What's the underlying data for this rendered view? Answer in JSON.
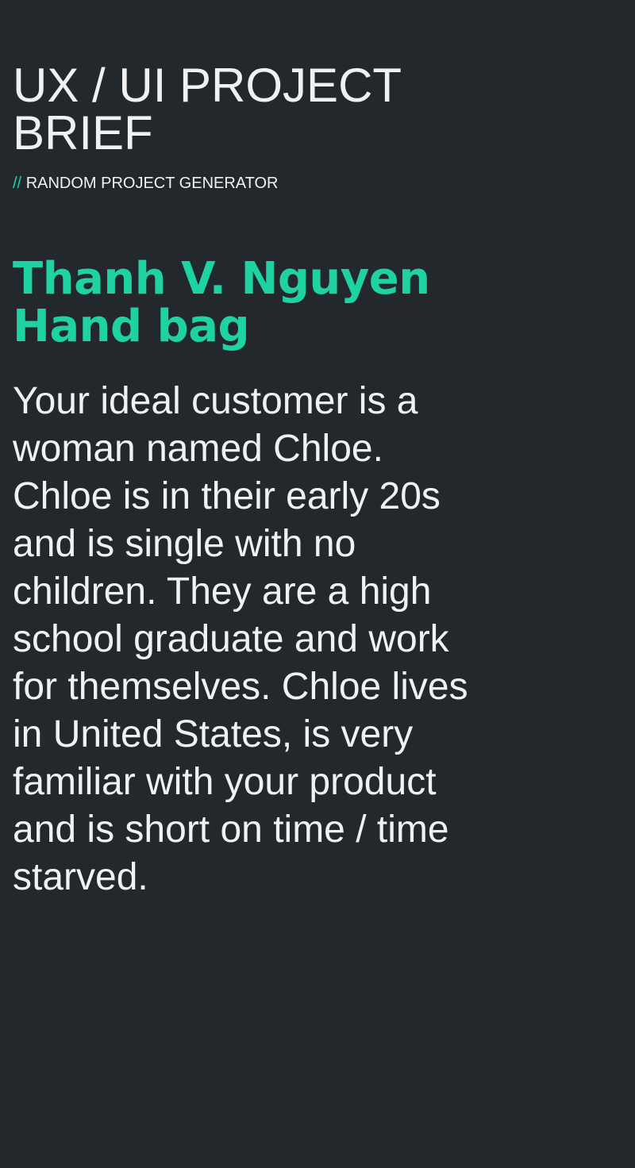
{
  "header": {
    "title_line1": "UX / UI PROJECT",
    "title_line2": "BRIEF",
    "tagline_prefix": "//",
    "tagline": "RANDOM PROJECT GENERATOR"
  },
  "project": {
    "client_name": "Thanh V. Nguyen",
    "product": "Hand bag"
  },
  "brief": {
    "lines": [
      "Your ideal customer is a",
      "woman named Chloe.",
      "Chloe is in their early 20s",
      "and is single with no",
      "children. They are a high",
      "school graduate and work",
      "for themselves. Chloe lives",
      "in United States, is very",
      "familiar with your product",
      "and is short on time / time",
      "starved."
    ]
  },
  "colors": {
    "background": "#23282d",
    "text": "#f1f1f1",
    "accent": "#1ed2a1"
  }
}
